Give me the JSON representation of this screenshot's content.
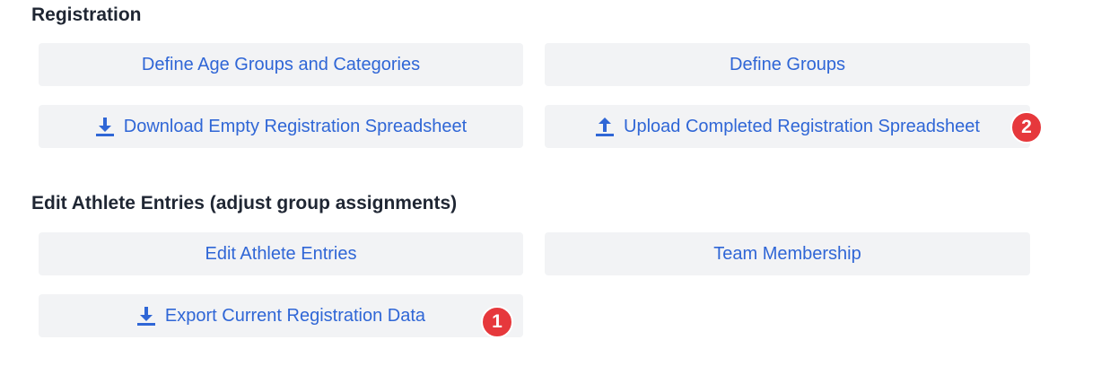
{
  "sections": {
    "registration": {
      "title": "Registration",
      "buttons": {
        "define_age_groups": "Define Age Groups and Categories",
        "define_groups": "Define Groups",
        "download_empty": "Download Empty Registration Spreadsheet",
        "upload_completed": "Upload Completed Registration Spreadsheet"
      },
      "badge": "2"
    },
    "athlete_entries": {
      "title": "Edit Athlete Entries (adjust group assignments)",
      "buttons": {
        "edit_athlete_entries": "Edit Athlete Entries",
        "team_membership": "Team Membership",
        "export_current": "Export Current Registration Data"
      },
      "badge": "1"
    }
  },
  "icons": {
    "download": "download-icon",
    "upload": "upload-icon"
  },
  "colors": {
    "button_bg": "#f2f3f5",
    "link_blue": "#2f66d6",
    "badge_red": "#e6383c",
    "heading": "#1f2633"
  }
}
